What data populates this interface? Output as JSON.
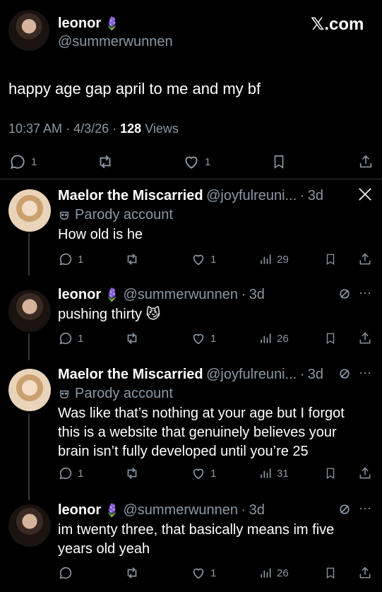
{
  "header": {
    "author_name": "leonor",
    "author_emoji": "🪻",
    "author_handle": "@summerwunnen",
    "brand": "𝕏.com"
  },
  "main_post": {
    "text": "happy age gap april to me and my bf",
    "time": "10:37 AM",
    "date": "4/3/26",
    "views_count": "128",
    "views_label": "Views",
    "replies": "1",
    "likes": "1"
  },
  "replies": [
    {
      "name": "Maelor the Miscarried",
      "handle": "@joyfulreuni...",
      "age": "3d",
      "badge": "Parody account",
      "text": "How old is he",
      "replies": "1",
      "likes": "1",
      "views": "29"
    },
    {
      "name": "leonor",
      "emoji": "🪻",
      "handle": "@summerwunnen",
      "age": "3d",
      "text": "pushing thirty 😼",
      "replies": "1",
      "likes": "1",
      "views": "26"
    },
    {
      "name": "Maelor the Miscarried",
      "handle": "@joyfulreuni...",
      "age": "3d",
      "badge": "Parody account",
      "text": "Was like that’s nothing at your age but I forgot this is a website that genuinely believes your brain isn’t fully developed until you’re 25",
      "replies": "1",
      "likes": "1",
      "views": "31"
    },
    {
      "name": "leonor",
      "emoji": "🪻",
      "handle": "@summerwunnen",
      "age": "3d",
      "text": "im twenty three, that basically means im five years old yeah",
      "likes": "1",
      "views": "26"
    }
  ],
  "icons": {
    "reply": "reply-icon",
    "retweet": "retweet-icon",
    "like": "heart-icon",
    "bookmark": "bookmark-icon",
    "share": "share-icon",
    "views": "views-icon",
    "more": "more-icon",
    "grok": "grok-icon",
    "mask": "mask-icon",
    "x_logo": "x-logo-icon"
  },
  "colors": {
    "background": "#000000",
    "text": "#ffffff",
    "muted": "#8b98a5",
    "separator": "#2f3336"
  }
}
